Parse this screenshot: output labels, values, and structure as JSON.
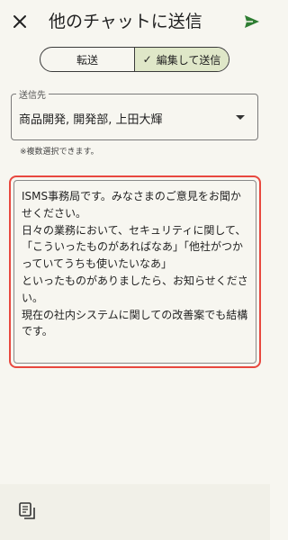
{
  "header": {
    "title": "他のチャットに送信",
    "close_icon": "close-icon",
    "send_icon": "send-icon",
    "accent_color": "#2e7d32"
  },
  "segmented": {
    "forward_label": "転送",
    "edit_send_label": "編集して送信",
    "active": "edit_send",
    "check_icon": "check-icon"
  },
  "destination": {
    "label": "送信先",
    "value": "商品開発, 開発部, 上田大輝",
    "helper": "※複数選択できます。"
  },
  "message": {
    "text": "ISMS事務局です。みなさまのご意見をお聞かせください。\n日々の業務において、セキュリティに関して、\n「こういったものがあればなあ」「他社がつかっていてうちも使いたいなあ」\nといったものがありましたら、お知らせください。\n現在の社内システムに関しての改善案でも結構です。",
    "highlight_color": "#e8483f"
  },
  "bottom_bar": {
    "copy_icon": "copy-icon"
  }
}
